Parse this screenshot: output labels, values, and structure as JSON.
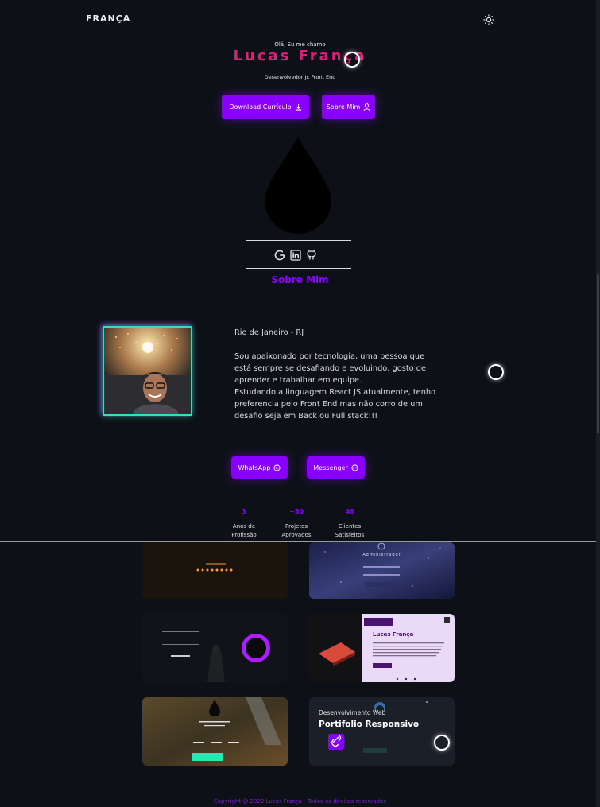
{
  "header": {
    "brand": "FRANÇA",
    "theme_icon": "sun-icon"
  },
  "hero": {
    "greeting": "Olá, Eu me chamo",
    "name": "Lucas França",
    "role": "Desenvolvedor Jr. Front End",
    "download_label": "Download Currículo",
    "about_label": "Sobre Mim"
  },
  "social": {
    "icons": [
      "google-icon",
      "linkedin-icon",
      "github-icon"
    ]
  },
  "about": {
    "title": "Sobre Mim",
    "location": "Rio de Janeiro - RJ",
    "bio": "Sou apaixonado por tecnologia, uma pessoa que\nestá sempre se desafiando e evoluindo, gosto de\naprender e trabalhar em equipe.\nEstudando a linguagem React JS atualmente, tenho\npreferencia pelo Front End mas não corro de um\ndesafio seja em Back ou Full stack!!!",
    "whatsapp_label": "WhatsApp",
    "messenger_label": "Messenger"
  },
  "stats": [
    {
      "value": "3",
      "label": "Anos de\nProfissão"
    },
    {
      "value": "+50",
      "label": "Projetos\nAprovados"
    },
    {
      "value": "46",
      "label": "Clientes\nSatisfeitos"
    }
  ],
  "portfolio": {
    "admin_title": "Administrador",
    "profile_name": "Lucas França",
    "web_title": "Desenvolvimento Web",
    "web_subtitle": "Portifolio Responsivo"
  },
  "footer": {
    "copyright": "Copyright @ 2022 Lucas França - Todos os direitos reservados"
  },
  "colors": {
    "accent": "#8a00ff",
    "name": "#e31c79",
    "teal": "#35e0b9",
    "bg": "#0d1117"
  }
}
